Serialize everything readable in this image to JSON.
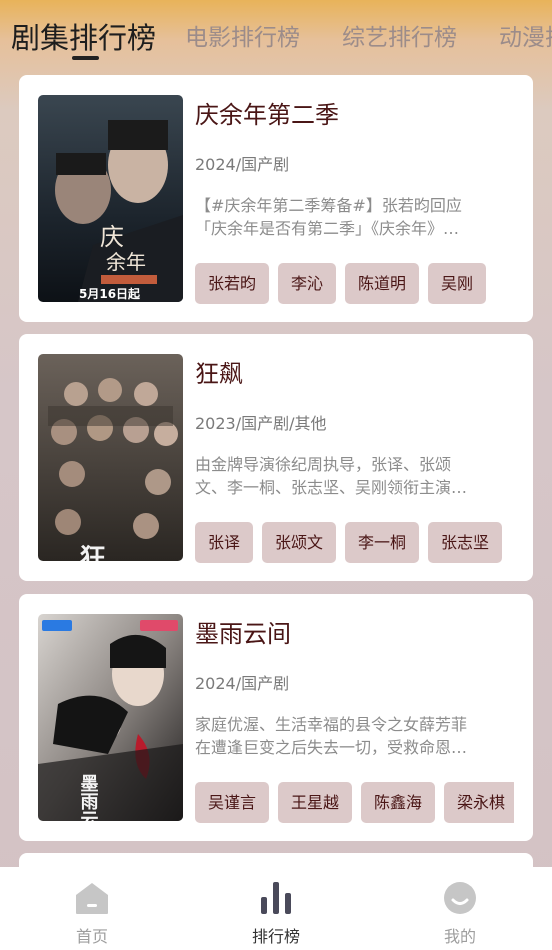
{
  "tabs": [
    {
      "label": "剧集排行榜",
      "active": true
    },
    {
      "label": "电影排行榜",
      "active": false
    },
    {
      "label": "综艺排行榜",
      "active": false
    },
    {
      "label": "动漫排行榜",
      "active": false
    }
  ],
  "cards": [
    {
      "title": "庆余年第二季",
      "meta": "2024/国产剧",
      "desc_line1": "【#庆余年第二季筹备#】张若昀回应",
      "desc_line2": "「庆余年是否有第二季」《庆余年》…",
      "cast": [
        "张若昀",
        "李沁",
        "陈道明",
        "吴刚"
      ],
      "poster_text": "5月16日起"
    },
    {
      "title": "狂飙",
      "meta": "2023/国产剧/其他",
      "desc_line1": "由金牌导演徐纪周执导，张译、张颂",
      "desc_line2": "文、李一桐、张志坚、吴刚领衔主演…",
      "cast": [
        "张译",
        "张颂文",
        "李一桐",
        "张志坚"
      ],
      "poster_text": "狂飙"
    },
    {
      "title": "墨雨云间",
      "meta": "2024/国产剧",
      "desc_line1": "家庭优渥、生活幸福的县令之女薛芳菲",
      "desc_line2": "在遭逢巨变之后失去一切，受救命恩…",
      "cast": [
        "吴谨言",
        "王星越",
        "陈鑫海",
        "梁永棋"
      ],
      "poster_text": "墨雨云间"
    }
  ],
  "nav": {
    "home": "首页",
    "rank": "排行榜",
    "mine": "我的"
  },
  "colors": {
    "accent_text": "#4a1616",
    "chip_bg": "#dcc9c9"
  },
  "icons": {
    "home": "home-icon",
    "rank": "bar-chart-icon",
    "mine": "smile-face-icon"
  }
}
